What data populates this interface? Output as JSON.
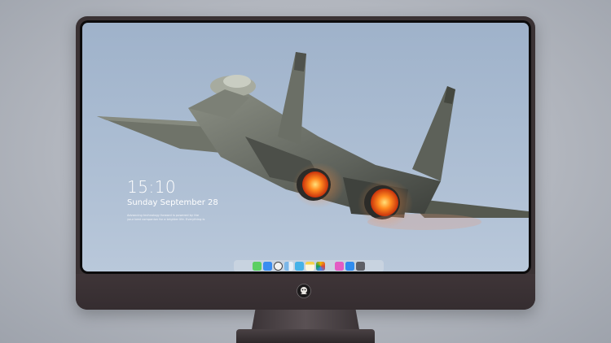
{
  "lock_screen": {
    "time": "15:10",
    "date": "Sunday September 28",
    "caption_lines": [
      "Advancing technology forward is powered by the",
      "your best companion for a brighter life. Everything is"
    ]
  },
  "dock": {
    "apps": [
      {
        "name": "messages-icon",
        "color": "#5ccf62"
      },
      {
        "name": "mail-icon",
        "color": "#3a8df0"
      },
      {
        "name": "clock-app-icon",
        "color": "#f2f2f2"
      },
      {
        "name": "finder-icon",
        "color": "#7bb7e8"
      },
      {
        "name": "video-app-icon",
        "color": "#46b2e8"
      },
      {
        "name": "notes-icon",
        "color": "#f6d34a"
      },
      {
        "name": "photos-icon",
        "color": "#e9ecef"
      },
      {
        "name": "music-icon",
        "color": "#e35cc3"
      },
      {
        "name": "app-store-icon",
        "color": "#2f8cf0"
      },
      {
        "name": "system-icon",
        "color": "#5e5f66"
      }
    ]
  },
  "colors": {
    "bezel": "#3a3234",
    "sky": "#a9bbd1",
    "afterburner": "#ff6a12"
  }
}
